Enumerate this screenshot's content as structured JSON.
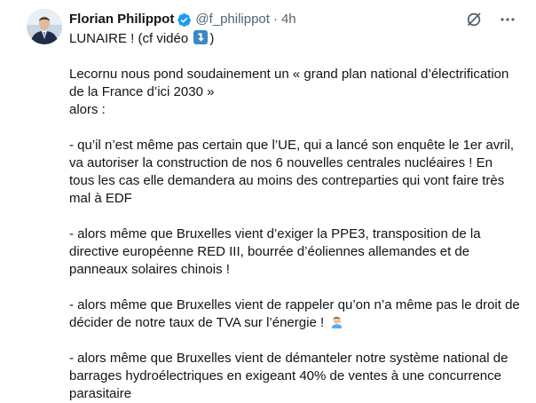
{
  "author": {
    "display_name": "Florian Philippot",
    "handle": "@f_philippot",
    "separator": "·",
    "time": "4h"
  },
  "icons": {
    "verified": "verified-badge-icon",
    "grok": "grok-icon",
    "more": "more-icon",
    "arrow": "arrow-down-emoji-icon",
    "face": "facepalm-emoji-icon"
  },
  "colors": {
    "verified": "#1d9bf0",
    "text": "#0f1419",
    "secondary": "#536471"
  },
  "tweet": {
    "headline_before": "LUNAIRE ! (cf vidéo ",
    "headline_after": ")",
    "lines": [
      "Lecornu nous pond soudainement un « grand plan national d’électrification",
      "de la France d’ici 2030 »",
      "alors :",
      "",
      "- qu’il n’est même pas certain que l’UE, qui a lancé son enquête le 1er avril,",
      "va autoriser la construction de nos 6 nouvelles centrales nucléaires ! En",
      "tous les cas elle demandera au moins des contreparties qui vont faire très",
      "mal à EDF",
      "",
      "- alors même que Bruxelles vient d’exiger la PPE3, transposition de la",
      "directive européenne RED III, bourrée d’éoliennes allemandes et de",
      "panneaux solaires chinois !",
      "",
      "- alors même que Bruxelles vient de rappeler qu’on n’a même pas le droit de",
      "décider de notre taux de TVA sur l’énergie ! ",
      "",
      "- alors même que Bruxelles vient de démanteler notre système national de",
      "barrages hydroélectriques en exigeant 40% de ventes à une concurrence",
      "parasitaire"
    ]
  }
}
